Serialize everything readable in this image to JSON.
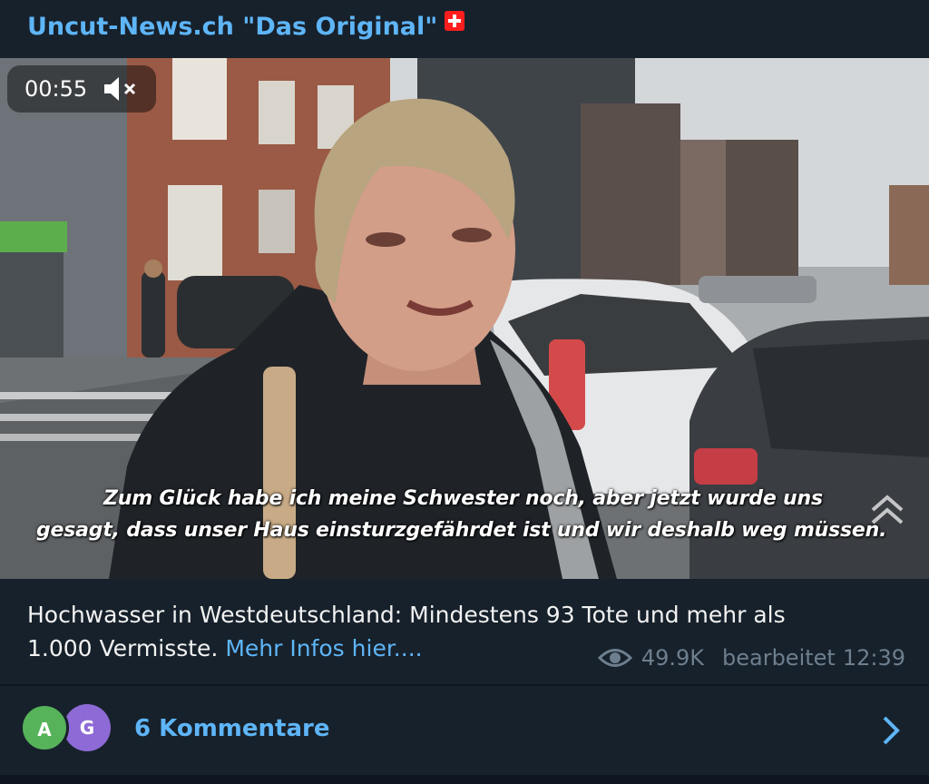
{
  "channel": {
    "title": "Uncut-News.ch \"Das Original\"",
    "flag_icon": "swiss-flag-icon"
  },
  "video": {
    "duration": "00:55",
    "mute_icon": "speaker-muted-icon",
    "subtitle_line1": "Zum Glück habe ich meine Schwester noch, aber jetzt wurde uns",
    "subtitle_line2": "gesagt, dass unser Haus einsturzgefährdet ist und wir deshalb weg müssen."
  },
  "post": {
    "caption_line1": "Hochwasser in Westdeutschland: Mindestens 93 Tote und mehr als",
    "caption_line2": "1.000 Vermisste.",
    "more_link": "Mehr Infos hier....",
    "views": "49.9K",
    "edited_label": "bearbeitet",
    "time": "12:39"
  },
  "comments": {
    "avatars": [
      "A",
      "G"
    ],
    "label": "6 Kommentare"
  },
  "colors": {
    "background": "#17212b",
    "accent": "#5eb5f7",
    "meta": "#6d7f8f",
    "avatar_a": "#56b35a",
    "avatar_g": "#8e6ad6"
  }
}
